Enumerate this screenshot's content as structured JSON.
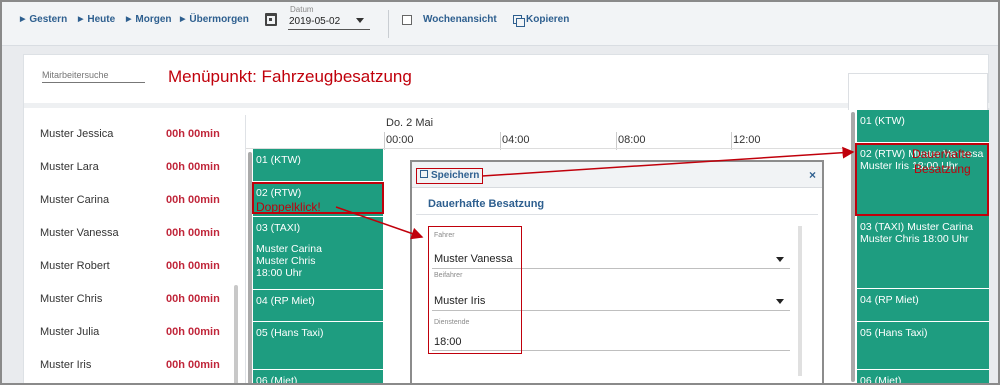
{
  "toolbar": {
    "nav": [
      "Gestern",
      "Heute",
      "Morgen",
      "Übermorgen"
    ],
    "date_label": "Datum",
    "date_value": "2019-05-02",
    "week_view": "Wochenansicht",
    "copy": "Kopieren"
  },
  "search": {
    "placeholder": "Mitarbeitersuche"
  },
  "annotation_heading": "Menüpunkt: Fahrzeugbesatzung",
  "employees": [
    {
      "name": "Muster Jessica",
      "time": "00h 00min"
    },
    {
      "name": "Muster Lara",
      "time": "00h 00min"
    },
    {
      "name": "Muster Carina",
      "time": "00h 00min"
    },
    {
      "name": "Muster Vanessa",
      "time": "00h 00min"
    },
    {
      "name": "Muster Robert",
      "time": "00h 00min"
    },
    {
      "name": "Muster Chris",
      "time": "00h 00min"
    },
    {
      "name": "Muster Julia",
      "time": "00h 00min"
    },
    {
      "name": "Muster Iris",
      "time": "00h 00min"
    }
  ],
  "timeline": {
    "day": "Do. 2 Mai",
    "hours": [
      "00:00",
      "04:00",
      "08:00",
      "12:00"
    ]
  },
  "vehicles": [
    {
      "title": "01 (KTW)",
      "lines": []
    },
    {
      "title": "02 (RTW)",
      "lines": []
    },
    {
      "title": "03 (TAXI)",
      "lines": [
        "Muster Carina",
        "Muster Chris",
        "18:00 Uhr"
      ]
    },
    {
      "title": "04 (RP Miet)",
      "lines": []
    },
    {
      "title": "05 (Hans Taxi)",
      "lines": []
    },
    {
      "title": "06 (Miet)",
      "lines": []
    }
  ],
  "right_vehicles": [
    {
      "title": "01 (KTW)",
      "lines": []
    },
    {
      "title": "02 (RTW)",
      "lines": [
        "Muster Vanessa",
        "Muster Iris",
        "18:00 Uhr"
      ]
    },
    {
      "title": "03 (TAXI)",
      "lines": [
        "Muster Carina",
        "Muster Chris",
        "18:00 Uhr"
      ]
    },
    {
      "title": "04 (RP Miet)",
      "lines": []
    },
    {
      "title": "05 (Hans Taxi)",
      "lines": []
    },
    {
      "title": "06 (Miet)",
      "lines": []
    }
  ],
  "popup": {
    "save": "Speichern",
    "close": "×",
    "title": "Dauerhafte Besatzung",
    "fields": [
      {
        "label": "Fahrer",
        "value": "Muster Vanessa"
      },
      {
        "label": "Beifahrer",
        "value": "Muster Iris"
      },
      {
        "label": "Dienstende",
        "value": "18:00"
      }
    ]
  },
  "annotations": {
    "doubleclick": "Doppelklick!",
    "permanent_line1": "Dauerhafte",
    "permanent_line2": "Besatzung"
  },
  "colors": {
    "vehicle_bg": "#1e9d80",
    "annotation": "#c0000b",
    "link": "#2e5f8f",
    "time_red": "#c0263a"
  }
}
